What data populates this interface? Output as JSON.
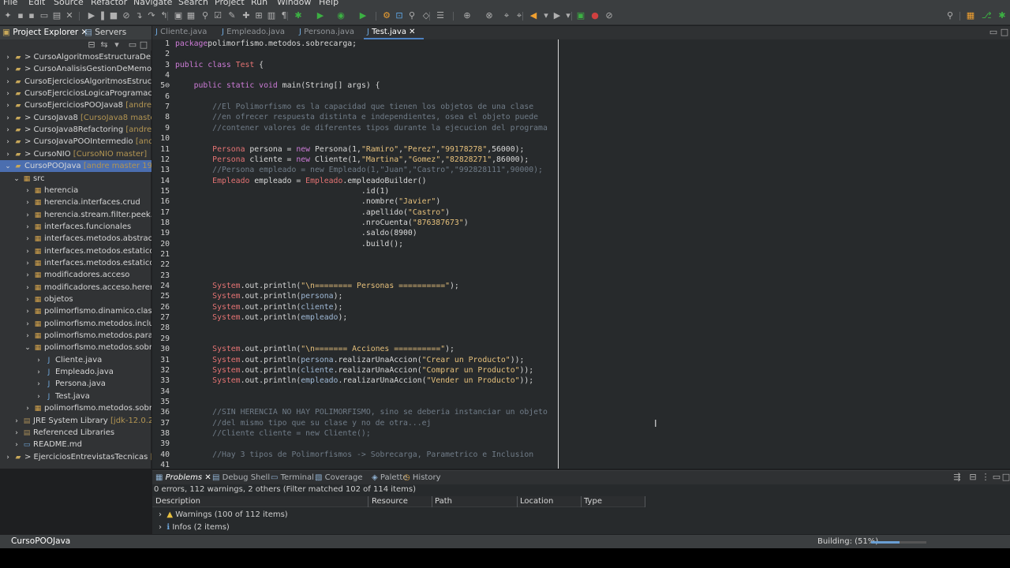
{
  "menu": [
    "File",
    "Edit",
    "Source",
    "Refactor",
    "Navigate",
    "Search",
    "Project",
    "Run",
    "Window",
    "Help"
  ],
  "left_tabs": {
    "project_explorer": "Project Explorer",
    "servers": "Servers"
  },
  "tree": [
    {
      "label": "> CursoAlgoritmosEstructuraDeDatos",
      "deco": "",
      "kind": "project"
    },
    {
      "label": "> CursoAnalisisGestionDeMemoriaJava",
      "deco": "",
      "kind": "project"
    },
    {
      "label": "CursoEjerciciosAlgoritmosEstructuras",
      "deco": "",
      "kind": "project"
    },
    {
      "label": "CursoEjerciciosLogicaProgramacion",
      "deco": "",
      "kind": "project"
    },
    {
      "label": "CursoEjerciciosPOOJava8",
      "deco": " [andre mas",
      "kind": "project"
    },
    {
      "label": "> CursoJava8",
      "deco": " [CursoJava8 master]",
      "kind": "project"
    },
    {
      "label": "> CursoJava8Refactoring",
      "deco": " [andre mas",
      "kind": "project"
    },
    {
      "label": "> CursoJavaPOOIntermedio",
      "deco": " [andre m",
      "kind": "project"
    },
    {
      "label": "> CursoNIO",
      "deco": " [CursoNIO master]",
      "kind": "project"
    },
    {
      "label": "CursoPOOJava",
      "deco": " [andre master 19 →8",
      "kind": "project-open"
    },
    {
      "label": "src",
      "deco": "",
      "kind": "src"
    },
    {
      "label": "herencia",
      "deco": "",
      "kind": "pkg"
    },
    {
      "label": "herencia.interfaces.crud",
      "deco": "",
      "kind": "pkg"
    },
    {
      "label": "herencia.stream.filter.peek.java",
      "deco": "",
      "kind": "pkg"
    },
    {
      "label": "interfaces.funcionales",
      "deco": "",
      "kind": "pkg"
    },
    {
      "label": "interfaces.metodos.abstractos",
      "deco": "",
      "kind": "pkg"
    },
    {
      "label": "interfaces.metodos.estaticos.al",
      "deco": "",
      "kind": "pkg"
    },
    {
      "label": "interfaces.metodos.estaticos.al",
      "deco": "",
      "kind": "pkg"
    },
    {
      "label": "modificadores.acceso",
      "deco": "",
      "kind": "pkg"
    },
    {
      "label": "modificadores.acceso.herencia",
      "deco": "",
      "kind": "pkg"
    },
    {
      "label": "objetos",
      "deco": "",
      "kind": "pkg"
    },
    {
      "label": "polimorfismo.dinamico.clases",
      "deco": "",
      "kind": "pkg"
    },
    {
      "label": "polimorfismo.metodos.inclusio",
      "deco": "",
      "kind": "pkg"
    },
    {
      "label": "polimorfismo.metodos.parame",
      "deco": "",
      "kind": "pkg"
    },
    {
      "label": "polimorfismo.metodos.sobrec",
      "deco": "",
      "kind": "pkg-open"
    },
    {
      "label": "Cliente.java",
      "deco": "",
      "kind": "java"
    },
    {
      "label": "Empleado.java",
      "deco": "",
      "kind": "java"
    },
    {
      "label": "Persona.java",
      "deco": "",
      "kind": "java"
    },
    {
      "label": "Test.java",
      "deco": "",
      "kind": "java"
    },
    {
      "label": "polimorfismo.metodos.sobrec",
      "deco": "",
      "kind": "pkg"
    },
    {
      "label": "JRE System Library",
      "deco": " [jdk-12.0.2]",
      "kind": "lib"
    },
    {
      "label": "Referenced Libraries",
      "deco": "",
      "kind": "lib"
    },
    {
      "label": "README.md",
      "deco": "",
      "kind": "file"
    },
    {
      "label": "> EjerciciosEntrevistasTecnicas",
      "deco": " [andr",
      "kind": "project"
    }
  ],
  "editor_tabs": [
    "Cliente.java",
    "Empleado.java",
    "Persona.java",
    "Test.java"
  ],
  "code_lines": [
    [
      [
        "kw",
        "package"
      ],
      [
        "",
        "polimorfismo.metodos.sobrecarga;"
      ]
    ],
    [],
    [
      [
        "kw",
        "public class "
      ],
      [
        "tp",
        "Test"
      ],
      [
        "",
        " {"
      ]
    ],
    [],
    [
      [
        "",
        "    "
      ],
      [
        "kw",
        "public static void "
      ],
      [
        "",
        "main(String[] args) {"
      ]
    ],
    [],
    [
      [
        "cm",
        "        //El Polimorfismo es la capacidad que tienen los objetos de una clase"
      ]
    ],
    [
      [
        "cm",
        "        //en ofrecer respuesta distinta e independientes, osea el objeto puede"
      ]
    ],
    [
      [
        "cm",
        "        //contener valores de diferentes tipos durante la ejecucion del programa"
      ]
    ],
    [],
    [
      [
        "tp",
        "        Persona "
      ],
      [
        "",
        "persona = "
      ],
      [
        "kw",
        "new "
      ],
      [
        "",
        "Persona(1,"
      ],
      [
        "st",
        "\"Ramiro\""
      ],
      [
        "",
        ","
      ],
      [
        "st",
        "\"Perez\""
      ],
      [
        "",
        ","
      ],
      [
        "st",
        "\"99178278\""
      ],
      [
        "",
        ",56000);"
      ]
    ],
    [
      [
        "tp",
        "        Persona "
      ],
      [
        "",
        "cliente = "
      ],
      [
        "kw",
        "new "
      ],
      [
        "",
        "Cliente(1,"
      ],
      [
        "st",
        "\"Martina\""
      ],
      [
        "",
        ","
      ],
      [
        "st",
        "\"Gomez\""
      ],
      [
        "",
        ","
      ],
      [
        "st",
        "\"82828271\""
      ],
      [
        "",
        ",86000);"
      ]
    ],
    [
      [
        "cm",
        "        //Persona empleado = new Empleado(1,\"Juan\",\"Castro\",\"992828111\",90000);"
      ]
    ],
    [
      [
        "tp",
        "        Empleado "
      ],
      [
        "",
        "empleado = "
      ],
      [
        "tp",
        "Empleado"
      ],
      [
        "",
        ".empleadoBuilder()"
      ]
    ],
    [
      [
        "",
        "                                        .id(1)"
      ]
    ],
    [
      [
        "",
        "                                        .nombre("
      ],
      [
        "st",
        "\"Javier\""
      ],
      [
        "",
        ")"
      ]
    ],
    [
      [
        "",
        "                                        .apellido("
      ],
      [
        "st",
        "\"Castro\""
      ],
      [
        "",
        ")"
      ]
    ],
    [
      [
        "",
        "                                        .nroCuenta("
      ],
      [
        "st",
        "\"876387673\""
      ],
      [
        "",
        ")"
      ]
    ],
    [
      [
        "",
        "                                        .saldo(8900)"
      ]
    ],
    [
      [
        "",
        "                                        .build();"
      ]
    ],
    [],
    [],
    [],
    [
      [
        "tp",
        "        System"
      ],
      [
        "",
        ".out.println("
      ],
      [
        "st",
        "\"\\n======== Personas ==========\""
      ],
      [
        "",
        ");"
      ]
    ],
    [
      [
        "tp",
        "        System"
      ],
      [
        "",
        ".out.println("
      ],
      [
        "vr",
        "persona"
      ],
      [
        "",
        ");"
      ]
    ],
    [
      [
        "tp",
        "        System"
      ],
      [
        "",
        ".out.println("
      ],
      [
        "vr",
        "cliente"
      ],
      [
        "",
        ");"
      ]
    ],
    [
      [
        "tp",
        "        System"
      ],
      [
        "",
        ".out.println("
      ],
      [
        "vr",
        "empleado"
      ],
      [
        "",
        ");"
      ]
    ],
    [],
    [],
    [
      [
        "tp",
        "        System"
      ],
      [
        "",
        ".out.println("
      ],
      [
        "st",
        "\"\\n======= Acciones ==========\""
      ],
      [
        "",
        ");"
      ]
    ],
    [
      [
        "tp",
        "        System"
      ],
      [
        "",
        ".out.println("
      ],
      [
        "vr",
        "persona"
      ],
      [
        "",
        ".realizarUnaAccion("
      ],
      [
        "st",
        "\"Crear un Producto\""
      ],
      [
        "",
        "));"
      ]
    ],
    [
      [
        "tp",
        "        System"
      ],
      [
        "",
        ".out.println("
      ],
      [
        "vr",
        "cliente"
      ],
      [
        "",
        ".realizarUnaAccion("
      ],
      [
        "st",
        "\"Comprar un Producto\""
      ],
      [
        "",
        "));"
      ]
    ],
    [
      [
        "tp",
        "        System"
      ],
      [
        "",
        ".out.println("
      ],
      [
        "vr",
        "empleado"
      ],
      [
        "",
        ".realizarUnaAccion("
      ],
      [
        "st",
        "\"Vender un Producto\""
      ],
      [
        "",
        "));"
      ]
    ],
    [],
    [],
    [
      [
        "cm",
        "        //SIN HERENCIA NO HAY POLIMORFISMO, sino se deberia instanciar un objeto"
      ]
    ],
    [
      [
        "cm",
        "        //del mismo tipo que su clase y no de otra...ej"
      ]
    ],
    [
      [
        "cm",
        "        //Cliente cliente = new Cliente();"
      ]
    ],
    [],
    [
      [
        "cm",
        "        //Hay 3 tipos de Polimorfismos -> Sobrecarga, Parametrico e Inclusion"
      ]
    ],
    []
  ],
  "bottom_tabs": [
    "Problems",
    "Debug Shell",
    "Terminal",
    "Coverage",
    "Palette",
    "History"
  ],
  "problems": {
    "summary": "0 errors, 112 warnings, 2 others (Filter matched 102 of 114 items)",
    "columns": [
      "Description",
      "Resource",
      "Path",
      "Location",
      "Type"
    ],
    "rows": [
      "Warnings (100 of 112 items)",
      "Infos (2 items)"
    ]
  },
  "status": {
    "project": "CursoPOOJava",
    "building": "Building: (51%)",
    "progress": 0.51
  }
}
